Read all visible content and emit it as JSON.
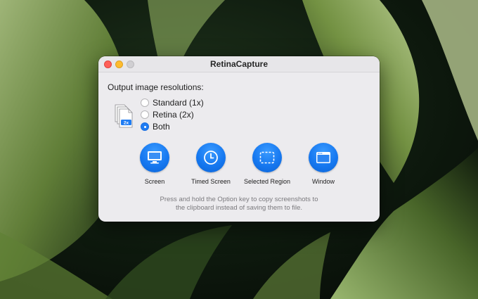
{
  "window": {
    "title": "RetinaCapture"
  },
  "resolution": {
    "label": "Output image resolutions:",
    "icon_badge": "2x",
    "options": [
      {
        "label": "Standard (1x)",
        "checked": false
      },
      {
        "label": "Retina (2x)",
        "checked": false
      },
      {
        "label": "Both",
        "checked": true
      }
    ]
  },
  "actions": [
    {
      "label": "Screen",
      "icon": "display-icon"
    },
    {
      "label": "Timed Screen",
      "icon": "clock-icon"
    },
    {
      "label": "Selected Region",
      "icon": "dashed-selection-icon"
    },
    {
      "label": "Window",
      "icon": "window-icon"
    }
  ],
  "footer": {
    "line1": "Press and hold the Option key to copy screenshots to",
    "line2": "the clipboard instead of saving them to file."
  },
  "colors": {
    "accent": "#1f7cf3",
    "close": "#fe5f57",
    "minimize": "#febc2e",
    "zoom_disabled": "#d0cfd2",
    "window_bg": "#ecebee"
  }
}
